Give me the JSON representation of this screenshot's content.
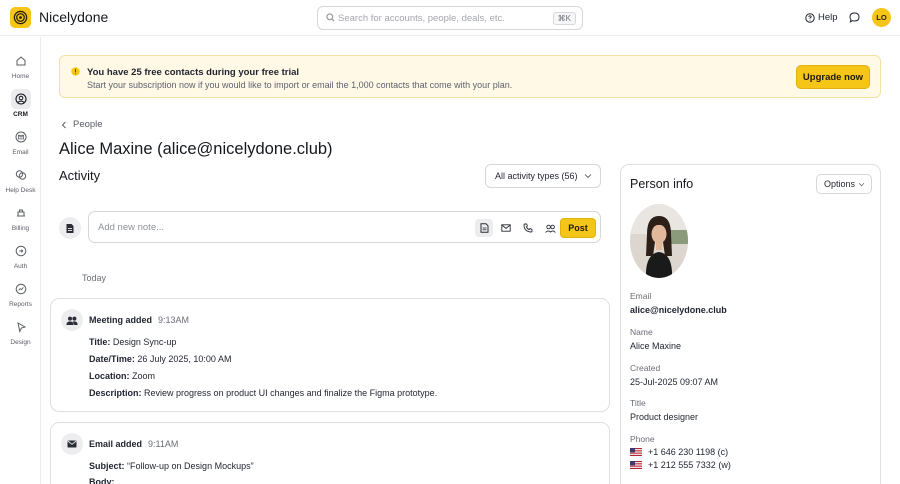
{
  "app": {
    "name": "Nicelydone"
  },
  "search": {
    "placeholder": "Search for accounts, people, deals, etc.",
    "shortcut": "⌘K"
  },
  "header": {
    "help_label": "Help",
    "avatar_initials": "LO"
  },
  "sidebar": {
    "items": [
      {
        "label": "Home",
        "icon": "home-icon"
      },
      {
        "label": "CRM",
        "icon": "crm-icon",
        "active": true
      },
      {
        "label": "Email",
        "icon": "email-icon"
      },
      {
        "label": "Help Desk",
        "icon": "help-desk-icon"
      },
      {
        "label": "Billing",
        "icon": "billing-icon"
      },
      {
        "label": "Auth",
        "icon": "auth-icon"
      },
      {
        "label": "Reports",
        "icon": "reports-icon"
      },
      {
        "label": "Design",
        "icon": "design-icon"
      }
    ]
  },
  "banner": {
    "title": "You have 25 free contacts during your free trial",
    "subtitle": "Start your subscription now if you would like to import or email the 1,000 contacts that come with your plan.",
    "button": "Upgrade now"
  },
  "breadcrumb": {
    "label": "People"
  },
  "page": {
    "title": "Alice Maxine (alice@nicelydone.club)"
  },
  "activity": {
    "title": "Activity",
    "filter_label": "All activity types (56)",
    "note_placeholder": "Add new note...",
    "post_label": "Post",
    "group_label": "Today",
    "items": [
      {
        "type": "Meeting added",
        "time": "9:13AM",
        "fields": [
          {
            "key": "Title:",
            "value": "Design Sync-up"
          },
          {
            "key": "Date/Time:",
            "value": "26 July 2025, 10:00 AM"
          },
          {
            "key": "Location:",
            "value": "Zoom"
          },
          {
            "key": "Description:",
            "value": "Review progress on product UI changes and finalize the Figma prototype."
          }
        ]
      },
      {
        "type": "Email added",
        "time": "9:11AM",
        "fields": [
          {
            "key": "Subject:",
            "value": "“Follow-up on Design Mockups”"
          },
          {
            "key": "Body:",
            "value": ""
          }
        ]
      }
    ]
  },
  "person": {
    "title": "Person info",
    "options_label": "Options",
    "fields": [
      {
        "label": "Email",
        "value": "alice@nicelydone.club"
      },
      {
        "label": "Name",
        "value": "Alice Maxine"
      },
      {
        "label": "Created",
        "value": "25-Jul-2025 09:07 AM"
      },
      {
        "label": "Title",
        "value": "Product designer"
      }
    ],
    "phone_label": "Phone",
    "phones": [
      "+1 646 230 1198 (c)",
      "+1 212 555 7332 (w)"
    ]
  },
  "colors": {
    "accent": "#f5c518",
    "banner_bg": "#fff9e6",
    "text": "#1f2330"
  }
}
